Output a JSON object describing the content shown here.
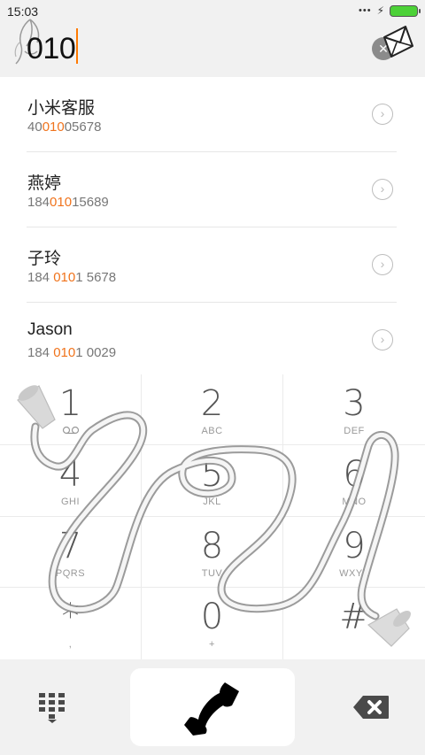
{
  "status": {
    "time": "15:03"
  },
  "dialer": {
    "input_value": "010"
  },
  "contacts": [
    {
      "name": "小米客服",
      "phone_pre": "40",
      "phone_hl": "010",
      "phone_post": "05678"
    },
    {
      "name": "燕婷",
      "phone_pre": "184",
      "phone_hl": "010",
      "phone_post": "15689"
    },
    {
      "name": "子玲",
      "phone_pre": "184 ",
      "phone_hl": "010",
      "phone_post": "1 5678"
    },
    {
      "name": "Jason",
      "phone_pre": "184 ",
      "phone_hl": "010",
      "phone_post": "1 0029"
    }
  ],
  "keys": [
    {
      "digit": "1",
      "letters": ""
    },
    {
      "digit": "2",
      "letters": "ABC"
    },
    {
      "digit": "3",
      "letters": "DEF"
    },
    {
      "digit": "4",
      "letters": "GHI"
    },
    {
      "digit": "5",
      "letters": "JKL"
    },
    {
      "digit": "6",
      "letters": "MNO"
    },
    {
      "digit": "7",
      "letters": "PQRS"
    },
    {
      "digit": "8",
      "letters": "TUV"
    },
    {
      "digit": "9",
      "letters": "WXYZ"
    },
    {
      "digit": "*",
      "letters": ","
    },
    {
      "digit": "0",
      "letters": "+"
    },
    {
      "digit": "#",
      "letters": ""
    }
  ],
  "colors": {
    "highlight": "#f0731c",
    "battery": "#4cd137",
    "background": "#f1f1f1"
  },
  "icons": [
    "bird-icon",
    "clear-icon",
    "envelope-icon",
    "chevron-right-icon",
    "voicemail-icon",
    "keypad-icon",
    "phone-icon",
    "backspace-icon"
  ]
}
